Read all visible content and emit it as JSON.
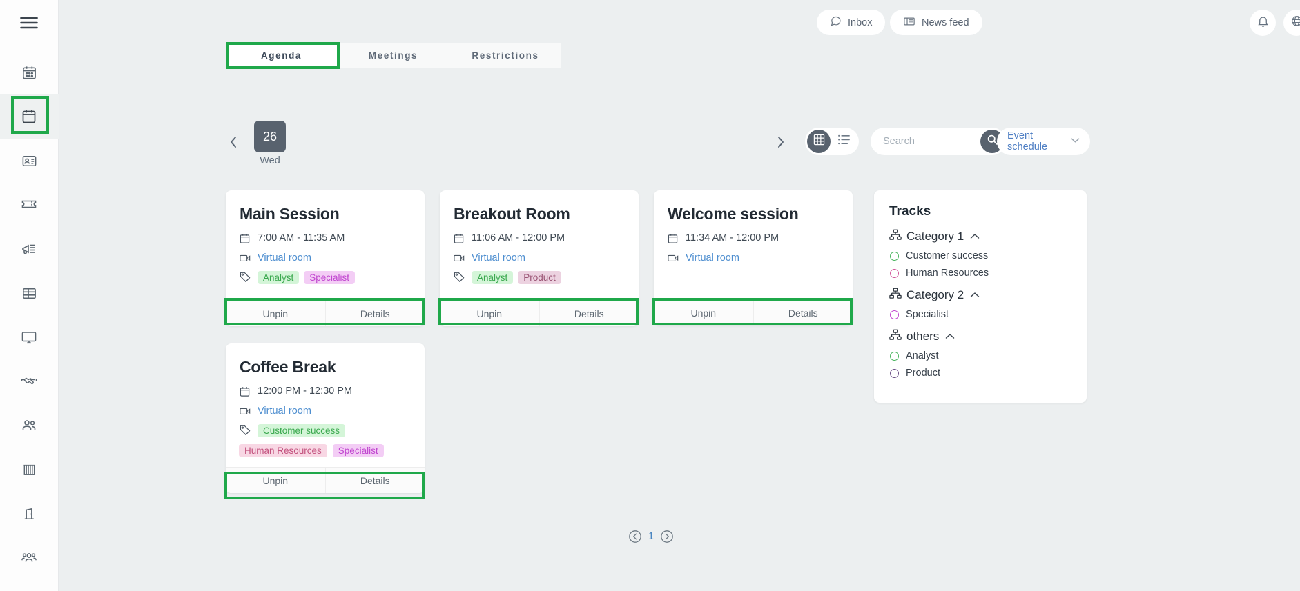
{
  "sidebar": {
    "items": [
      {
        "name": "hamburger-menu",
        "icon": "hamburger-icon"
      },
      {
        "name": "events-calendar",
        "icon": "calendar-days-icon"
      },
      {
        "name": "agenda-calendar",
        "icon": "calendar-icon",
        "active": true
      },
      {
        "name": "attendees-badge",
        "icon": "id-card-icon"
      },
      {
        "name": "tickets",
        "icon": "ticket-icon"
      },
      {
        "name": "campaigns",
        "icon": "megaphone-icon"
      },
      {
        "name": "reports-table",
        "icon": "table-icon"
      },
      {
        "name": "virtual-stage",
        "icon": "monitor-icon"
      },
      {
        "name": "sponsors",
        "icon": "handshake-icon"
      },
      {
        "name": "people",
        "icon": "users-icon"
      },
      {
        "name": "venue",
        "icon": "blinds-icon"
      },
      {
        "name": "rooms",
        "icon": "door-icon"
      },
      {
        "name": "groups",
        "icon": "people-group-icon"
      }
    ]
  },
  "topbar": {
    "inbox_label": "Inbox",
    "news_label": "News feed",
    "inbox_icon": "chat-bubble-icon",
    "news_icon": "newspaper-icon",
    "bell_icon": "bell-icon",
    "globe_icon": "globe-icon",
    "avatar_name": "user-avatar"
  },
  "tabs": [
    {
      "label": "Agenda",
      "active": true
    },
    {
      "label": "Meetings",
      "active": false
    },
    {
      "label": "Restrictions",
      "active": false
    }
  ],
  "datenav": {
    "prev_icon": "chevron-left-icon",
    "next_icon": "chevron-right-icon",
    "day_number": "26",
    "day_name": "Wed"
  },
  "toolbar": {
    "grid_view_icon": "grid-view-icon",
    "list_view_icon": "list-view-icon",
    "search_value": "",
    "search_placeholder": "Search",
    "search_icon": "search-icon",
    "schedule_label": "Event schedule",
    "schedule_chevron": "chevron-down-icon"
  },
  "cards": [
    {
      "title": "Main Session",
      "time": "7:00 AM - 11:35 AM",
      "room": "Virtual room",
      "time_icon": "calendar-icon",
      "room_icon": "video-camera-icon",
      "tag_icon": "tag-icon",
      "tags": [
        {
          "label": "Analyst",
          "style": "tag-green"
        },
        {
          "label": "Specialist",
          "style": "tag-purple"
        }
      ],
      "extra_tags": [],
      "unpin_label": "Unpin",
      "details_label": "Details",
      "highlighted": true
    },
    {
      "title": "Breakout Room",
      "time": "11:06 AM - 12:00 PM",
      "room": "Virtual room",
      "time_icon": "calendar-icon",
      "room_icon": "video-camera-icon",
      "tag_icon": "tag-icon",
      "tags": [
        {
          "label": "Analyst",
          "style": "tag-green"
        },
        {
          "label": "Product",
          "style": "tag-mauve"
        }
      ],
      "extra_tags": [],
      "unpin_label": "Unpin",
      "details_label": "Details",
      "highlighted": true
    },
    {
      "title": "Welcome session",
      "time": "11:34 AM - 12:00 PM",
      "room": "Virtual room",
      "time_icon": "calendar-icon",
      "room_icon": "video-camera-icon",
      "tag_icon": "tag-icon",
      "tags": [],
      "extra_tags": [],
      "unpin_label": "Unpin",
      "details_label": "Details",
      "highlighted": true
    },
    {
      "title": "Coffee Break",
      "time": "12:00 PM - 12:30 PM",
      "room": "Virtual room",
      "time_icon": "calendar-icon",
      "room_icon": "video-camera-icon",
      "tag_icon": "tag-icon",
      "tags": [
        {
          "label": "Customer success",
          "style": "tag-green"
        }
      ],
      "extra_tags": [
        {
          "label": "Human Resources",
          "style": "tag-pink"
        },
        {
          "label": "Specialist",
          "style": "tag-purple"
        }
      ],
      "unpin_label": "Unpin",
      "details_label": "Details",
      "highlighted": true
    }
  ],
  "tracks": {
    "title": "Tracks",
    "category_icon": "org-chart-icon",
    "caret_icon": "chevron-up-icon",
    "groups": [
      {
        "name": "Category 1",
        "items": [
          {
            "label": "Customer success",
            "color": "#49b45e"
          },
          {
            "label": "Human Resources",
            "color": "#d1559a"
          }
        ]
      },
      {
        "name": "Category 2",
        "items": [
          {
            "label": "Specialist",
            "color": "#c046cf"
          }
        ]
      },
      {
        "name": "others",
        "items": [
          {
            "label": "Analyst",
            "color": "#49b45e"
          },
          {
            "label": "Product",
            "color": "#6b4f86"
          }
        ]
      }
    ]
  },
  "pagination": {
    "prev_icon": "circle-chevron-left-icon",
    "page": "1",
    "next_icon": "circle-chevron-right-icon"
  },
  "colors": {
    "highlight": "#1fa84a",
    "accent_dark": "#58626e",
    "link_blue": "#4f8fd0",
    "page_bg": "#eceff0"
  }
}
